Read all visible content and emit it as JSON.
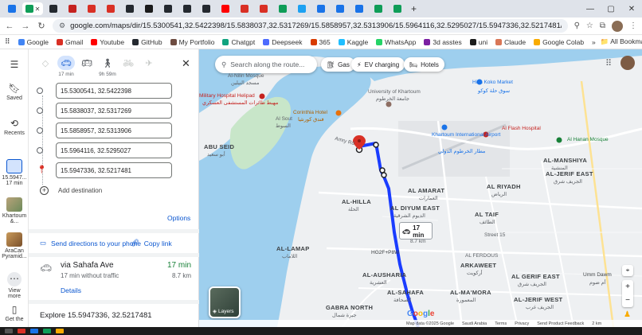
{
  "browser": {
    "url": "google.com/maps/dir/15.5300541,32.5422398/15.5838037,32.5317269/15.5858957,32.5313906/15.5964116,32.5295027/15.5947336,32.5217481/@15.5791143,32.5060332...",
    "tab_colors": [
      "#1a73e8",
      "#0f9d58",
      "#24292f",
      "#c5221f",
      "#d93025",
      "#d93025",
      "#24292f",
      "#1b1b1b",
      "#24292f",
      "#24292f",
      "#24292f",
      "#ff0000",
      "#d93025",
      "#d93025",
      "#0f9d58",
      "#1da1f2",
      "#1a73e8",
      "#1a73e8",
      "#1a73e8",
      "#0f9d58",
      "#0f9d58"
    ],
    "bookmarks": [
      {
        "label": "Google",
        "color": "#4285f4"
      },
      {
        "label": "Gmail",
        "color": "#d93025"
      },
      {
        "label": "Youtube",
        "color": "#ff0000"
      },
      {
        "label": "GitHub",
        "color": "#24292f"
      },
      {
        "label": "My Portfolio",
        "color": "#6d4c41"
      },
      {
        "label": "Chatgpt",
        "color": "#10a37f"
      },
      {
        "label": "Deepseek",
        "color": "#4d6bfe"
      },
      {
        "label": "365",
        "color": "#d83b01"
      },
      {
        "label": "Kaggle",
        "color": "#20beff"
      },
      {
        "label": "WhatsApp",
        "color": "#25d366"
      },
      {
        "label": "3d asstes",
        "color": "#7b1fa2"
      },
      {
        "label": "uni",
        "color": "#1b1b1b"
      },
      {
        "label": "Claude",
        "color": "#d97757"
      },
      {
        "label": "Google Colab",
        "color": "#f9ab00"
      }
    ],
    "all_bookmarks": "All Bookmarks"
  },
  "rail": {
    "saved": "Saved",
    "recents": "Recents",
    "recent1": "15.5947...",
    "recent1_sub": "17 min",
    "recent2": "Khartoum",
    "recent2_sub": "&...",
    "recent3": "AraCan",
    "recent3_sub": "Pyramid...",
    "view_more": "View more",
    "get_app": "Get the"
  },
  "directions": {
    "modes": [
      {
        "icon": "best-route-icon",
        "label": ""
      },
      {
        "icon": "car-icon",
        "label": "17 min"
      },
      {
        "icon": "transit-icon",
        "label": ""
      },
      {
        "icon": "walk-icon",
        "label": "9h 59m"
      },
      {
        "icon": "bike-icon",
        "label": ""
      },
      {
        "icon": "flight-icon",
        "label": ""
      }
    ],
    "stops": [
      "15.5300541, 32.5422398",
      "15.5838037, 32.5317269",
      "15.5858957, 32.5313906",
      "15.5964116, 32.5295027",
      "15.5947336, 32.5217481"
    ],
    "add_destination": "Add destination",
    "options": "Options",
    "send": "Send directions to your phone",
    "copy": "Copy link",
    "route": {
      "via": "via Sahafa Ave",
      "time": "17 min",
      "sub": "17 min without traffic",
      "distance": "8.7 km",
      "details": "Details"
    },
    "explore": "Explore 15.5947336, 32.5217481"
  },
  "map": {
    "search_placeholder": "Search along the route...",
    "chips": [
      "Gas",
      "EV charging",
      "Hotels"
    ],
    "badge_time": "17 min",
    "badge_dist": "8.7 km",
    "layers": "Layers",
    "labels": {
      "mosque": "Al-Nilin Mosque",
      "mosque_ar": "مسجد النيلين",
      "hospital": "Military Hospital Helipad",
      "hospital_ar": "مهبط طائرات المستشفى العسكري",
      "corinthia": "Corinthia Hotel",
      "corinthia_ar": "فندق كورنثيا",
      "uni": "University of Khartoum",
      "uni_ar": "جامعة الخرطوم",
      "koko": "Hilla Koko Market",
      "koko_ar": "سوق حلة كوكو",
      "flash": "Al Flash Hospital",
      "airport": "Khartoum International Airport",
      "airport_ar": "مطار الخرطوم الدولي",
      "hanan": "Al Hanan Mosque",
      "abuseid": "ABU SEID",
      "abuseid_ar": "أبو سعيد",
      "sout": "Al Sout",
      "sout_ar": "السوط",
      "amarat": "AL AMARAT",
      "amarat_ar": "العمارات",
      "riyadh": "AL RIYADH",
      "riyadh_ar": "الرياض",
      "manshiya": "AL-MANSHIYA",
      "manshiya_ar": "المنشية",
      "jerif": "AL-JERIF EAST",
      "jerif_ar": "الجريف شرق",
      "hilla": "AL-HILLA",
      "hilla_ar": "الحلة",
      "diyum": "AL DIYUM EAST",
      "diyum_ar": "الديوم الشرقية",
      "taif": "AL TAIF",
      "taif_ar": "الطائف",
      "lamap": "AL-LAMAP",
      "lamap_ar": "اللاماب",
      "plus": "HG2F+P8W",
      "ausharia": "AL-AUSHARIA",
      "ausharia_ar": "العشرية",
      "arkaweet": "ARKAWEET",
      "arkaweet_ar": "أركويت",
      "ferdous": "AL FERDOUS",
      "ferdous_ar": "الفردوس",
      "gerifeast": "AL GERIF EAST",
      "gerifeast_ar": "الجريف شرق",
      "sahafa": "AL-SAHAFA",
      "sahafa_ar": "الصحافة",
      "mamora": "AL-MA'MORA",
      "mamora_ar": "المعمورة",
      "gabra": "GABRA NORTH",
      "gabra_ar": "جبرة شمال",
      "jerifwest": "AL-JERIF WEST",
      "jerifwest_ar": "الجريف غرب",
      "ummdawm": "Umm Dawm",
      "ummdawm_ar": "أم ضوم",
      "amryrd": "Amry Rd",
      "street15": "Street 15"
    },
    "attribution": [
      "Map data ©2025 Google",
      "Saudi Arabia",
      "Terms",
      "Privacy",
      "Send Product Feedback",
      "2 km"
    ]
  },
  "colors": {
    "route": "#1a3cff",
    "water": "#9ecfee",
    "park": "#c8e6c9",
    "accent": "#0b57d0"
  }
}
